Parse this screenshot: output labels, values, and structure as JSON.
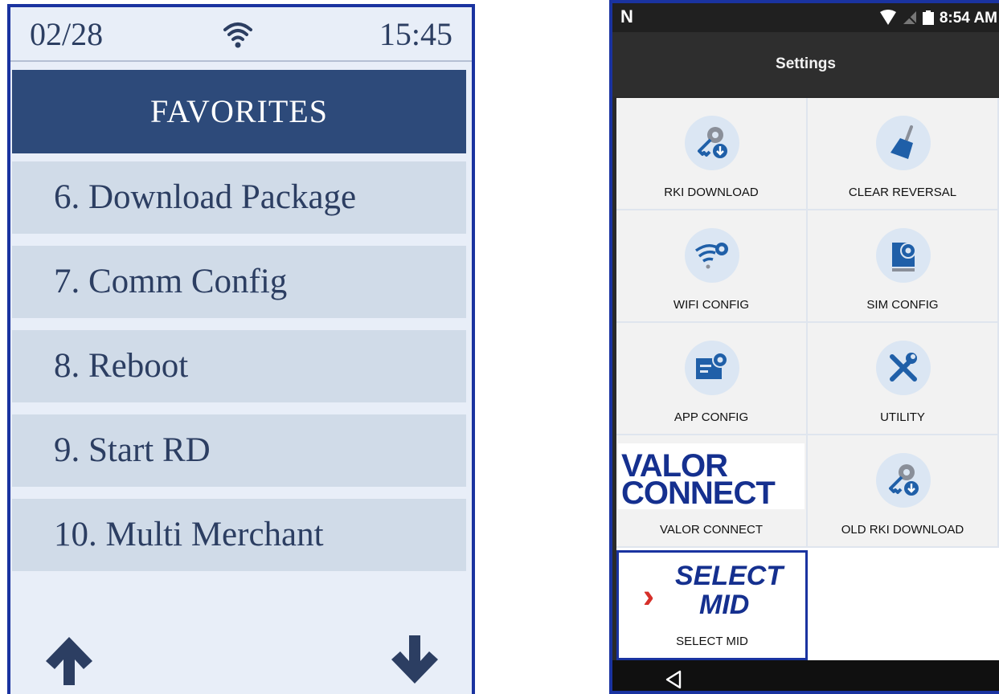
{
  "terminal": {
    "date": "02/28",
    "time": "15:45",
    "header": "FAVORITES",
    "items": [
      "6. Download Package",
      "7. Comm Config",
      "8. Reboot",
      "9. Start RD",
      "10. Multi Merchant"
    ],
    "icons": [
      "wifi-icon",
      "arrow-up-icon",
      "arrow-down-icon"
    ]
  },
  "android": {
    "status_logo": "N",
    "clock": "8:54 AM",
    "title": "Settings",
    "tiles": [
      {
        "label": "RKI DOWNLOAD",
        "icon": "key-download-icon"
      },
      {
        "label": "CLEAR REVERSAL",
        "icon": "broom-icon"
      },
      {
        "label": "WIFI CONFIG",
        "icon": "wifi-gear-icon"
      },
      {
        "label": "SIM CONFIG",
        "icon": "sim-gear-icon"
      },
      {
        "label": "APP CONFIG",
        "icon": "card-gear-icon"
      },
      {
        "label": "UTILITY",
        "icon": "tools-icon"
      },
      {
        "label": "VALOR CONNECT",
        "logo_line1": "VALOR",
        "logo_line2": "CONNECT"
      },
      {
        "label": "OLD RKI DOWNLOAD",
        "icon": "key-download-icon"
      },
      {
        "label": "SELECT MID",
        "logo_line1": "SELECT",
        "logo_line2": "MID"
      }
    ],
    "colors": {
      "brand_blue": "#15308f",
      "accent_red": "#d6302a",
      "icon_blue": "#1f5fa8"
    }
  }
}
